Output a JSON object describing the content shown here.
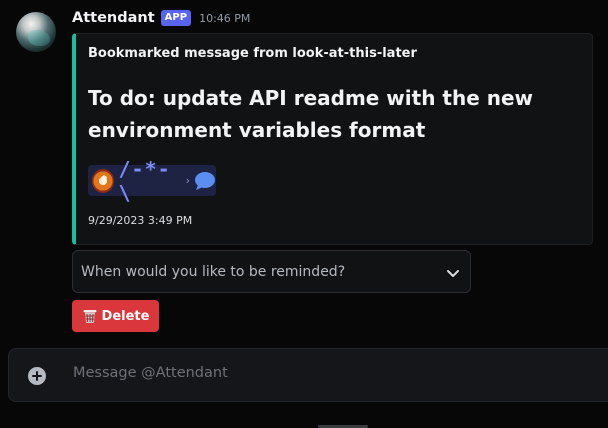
{
  "message": {
    "author": "Attendant",
    "app_tag": "APP",
    "timestamp": "10:46 PM"
  },
  "embed": {
    "accent_color": "#1abc9c",
    "author": "Bookmarked message from look-at-this-later",
    "title": "To do: update API readme with the new environment variables format",
    "emoji_row": {
      "text": "/-*-\\",
      "chevron": "›",
      "icons": [
        "server-badge-icon",
        "speech-bubble-icon"
      ]
    },
    "footer": "9/29/2023 3:49 PM"
  },
  "select": {
    "placeholder": "When would you like to be reminded?",
    "icon": "chevron-down-icon"
  },
  "delete_button": {
    "label": "Delete",
    "icon": "wastebasket-icon",
    "color": "#da373c"
  },
  "composer": {
    "placeholder": "Message @Attendant",
    "add_icon": "plus-circle-icon"
  }
}
